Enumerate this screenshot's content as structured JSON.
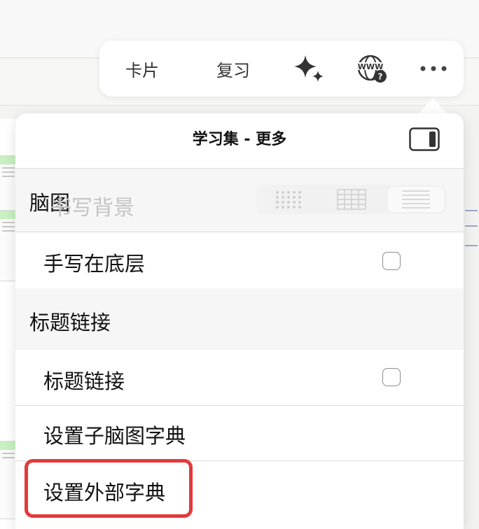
{
  "toolbar": {
    "cards_label": "卡片",
    "review_label": "复习",
    "icons": [
      "sparkle-icon",
      "web-help-icon",
      "more-icon"
    ]
  },
  "panel": {
    "title": "学习集 - 更多",
    "ghost_text": "书写背景",
    "rows": [
      {
        "type": "section",
        "label": "脑图"
      },
      {
        "type": "item",
        "label": "手写在底层",
        "checkbox": false
      },
      {
        "type": "section",
        "label": "标题链接"
      },
      {
        "type": "item",
        "label": "标题链接",
        "checkbox": false
      },
      {
        "type": "item",
        "label": "设置子脑图字典"
      },
      {
        "type": "item",
        "label": "设置外部字典"
      }
    ]
  },
  "colors": {
    "highlight": "#e23a3a",
    "section_bg": "#f6f6f6",
    "text": "#111111"
  }
}
